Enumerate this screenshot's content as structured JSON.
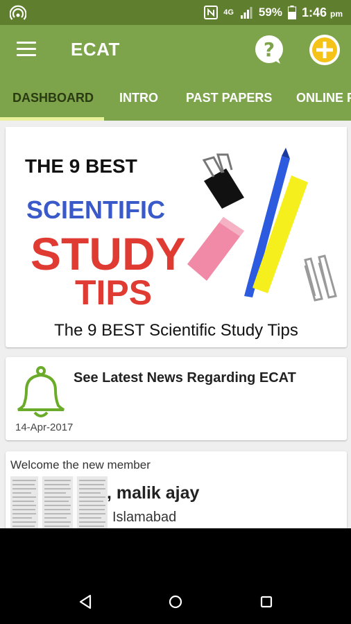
{
  "status_bar": {
    "battery": "59%",
    "time": "1:46",
    "ampm": "pm",
    "network": "4G"
  },
  "app_bar": {
    "title": "ECAT"
  },
  "tabs": [
    {
      "label": "DASHBOARD",
      "active": true
    },
    {
      "label": "INTRO",
      "active": false
    },
    {
      "label": "PAST PAPERS",
      "active": false
    },
    {
      "label": "ONLINE P",
      "active": false
    }
  ],
  "study_card": {
    "image_text": [
      "THE 9 BEST",
      "SCIENTIFIC",
      "STUDY",
      "TIPS"
    ],
    "caption": "The 9 BEST Scientific Study Tips"
  },
  "news_card": {
    "title": "See Latest News Regarding ECAT",
    "date": "14-Apr-2017"
  },
  "member_card": {
    "heading": "Welcome the new member",
    "name": ", malik ajay",
    "city": "Islamabad"
  },
  "colors": {
    "status_bar": "#5f7f2e",
    "app_bar": "#7da34b",
    "accent_yellow": "#f5c218",
    "tab_indicator": "#e9f29a"
  },
  "icons": {
    "menu": "menu-icon",
    "help": "help-icon",
    "add": "add-icon",
    "bell": "bell-icon",
    "back": "back-icon",
    "home": "home-icon",
    "recents": "recents-icon"
  }
}
